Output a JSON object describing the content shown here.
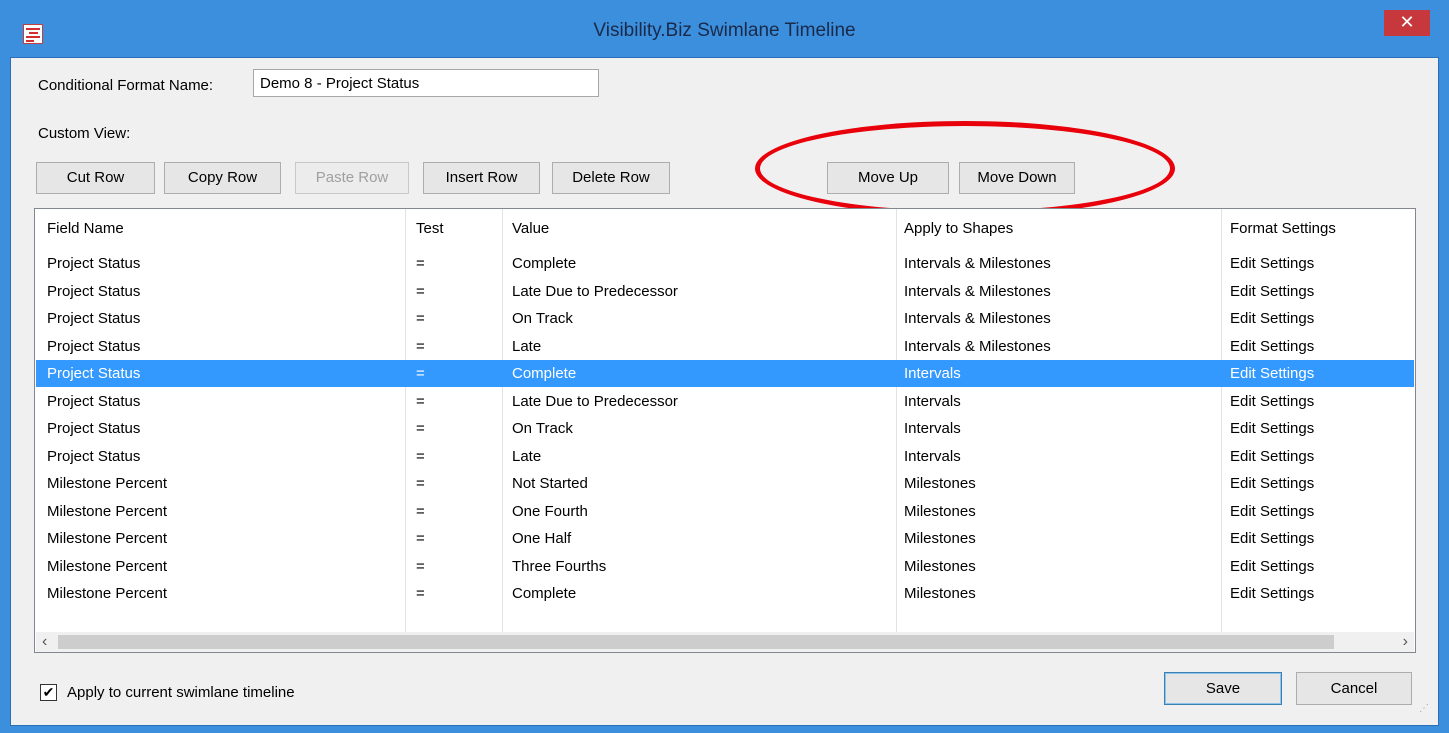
{
  "window": {
    "title": "Visibility.Biz Swimlane Timeline",
    "close_label": "✕"
  },
  "form": {
    "name_label": "Conditional Format Name:",
    "name_value": "Demo 8 - Project Status",
    "custom_view_label": "Custom View:"
  },
  "toolbar": {
    "cut_row": "Cut Row",
    "copy_row": "Copy Row",
    "paste_row": "Paste Row",
    "insert_row": "Insert Row",
    "delete_row": "Delete Row",
    "move_up": "Move Up",
    "move_down": "Move Down"
  },
  "grid": {
    "headers": [
      "Field Name",
      "Test",
      "Value",
      "Apply to Shapes",
      "Format Settings"
    ],
    "selected_index": 4,
    "rows": [
      [
        "Project Status",
        "=",
        "Complete",
        "Intervals & Milestones",
        "Edit Settings"
      ],
      [
        "Project Status",
        "=",
        "Late Due to Predecessor",
        "Intervals & Milestones",
        "Edit Settings"
      ],
      [
        "Project Status",
        "=",
        "On Track",
        "Intervals & Milestones",
        "Edit Settings"
      ],
      [
        "Project Status",
        "=",
        "Late",
        "Intervals & Milestones",
        "Edit Settings"
      ],
      [
        "Project Status",
        "=",
        "Complete",
        "Intervals",
        "Edit Settings"
      ],
      [
        "Project Status",
        "=",
        "Late Due to Predecessor",
        "Intervals",
        "Edit Settings"
      ],
      [
        "Project Status",
        "=",
        "On Track",
        "Intervals",
        "Edit Settings"
      ],
      [
        "Project Status",
        "=",
        "Late",
        "Intervals",
        "Edit Settings"
      ],
      [
        "Milestone Percent",
        "=",
        "Not Started",
        "Milestones",
        "Edit Settings"
      ],
      [
        "Milestone Percent",
        "=",
        "One Fourth",
        "Milestones",
        "Edit Settings"
      ],
      [
        "Milestone Percent",
        "=",
        "One Half",
        "Milestones",
        "Edit Settings"
      ],
      [
        "Milestone Percent",
        "=",
        "Three Fourths",
        "Milestones",
        "Edit Settings"
      ],
      [
        "Milestone Percent",
        "=",
        "Complete",
        "Milestones",
        "Edit Settings"
      ]
    ],
    "scroll_left": "‹",
    "scroll_right": "›"
  },
  "footer": {
    "apply_label": "Apply to current swimlane timeline",
    "apply_checked": true,
    "save": "Save",
    "cancel": "Cancel"
  },
  "colors": {
    "selection": "#3399ff",
    "highlight_oval": "#e8000a",
    "title_bar": "#3c8fdd",
    "close_button": "#c7383c"
  }
}
